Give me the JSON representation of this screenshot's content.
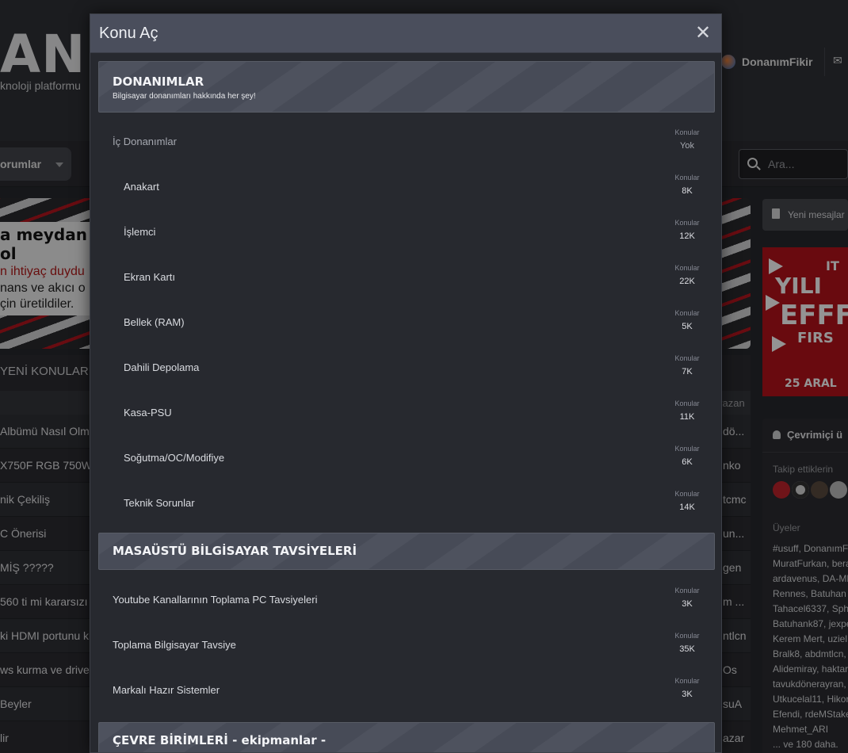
{
  "background": {
    "logo_text": "ANIM",
    "tagline": "knoloji platformu",
    "user_name": "DonanımFikir",
    "nav_forums": "orumlar",
    "search_placeholder": "Ara...",
    "banner": {
      "line1": "a meydan ol",
      "line2": "n ihtiyaç duydu",
      "line3": "nans ve akıcı o",
      "line4": "çin üretildiler."
    },
    "new_topics_title": "YENİ KONULAR",
    "list_author_header": "yazan",
    "rows": [
      {
        "title": "Albümü Nasıl Olm",
        "author": "dö..."
      },
      {
        "title": "X750F RGB 750W",
        "author": "nko"
      },
      {
        "title": "nik Çekiliş",
        "author": "tcmc"
      },
      {
        "title": "C Önerisi",
        "author": "un..."
      },
      {
        "title": "MİŞ ?????",
        "author": "gen"
      },
      {
        "title": "560 ti mi kararsızı",
        "author": "m ..."
      },
      {
        "title": "ki HDMI portunu k",
        "author": "ntlcn"
      },
      {
        "title": "ws kurma ve driver",
        "author": "Os"
      },
      {
        "title": "Beyler",
        "author": "suA"
      },
      {
        "title": "lir",
        "author": "azar"
      }
    ],
    "new_posts_button": "Yeni mesajlar",
    "ad": {
      "it": "IT",
      "line1": "YILI",
      "line2": "EFFF",
      "line3": "FIRS",
      "date": "25 ARAL"
    },
    "online_title": "Çevrimiçi ü",
    "followed_label": "Takip ettiklerin",
    "members_label": "Üyeler",
    "members": [
      "#usuff, DonanımF",
      "MuratFurkan, bera",
      "ardavenus, DA-MD",
      "Rennes, Batuhan A",
      "Tahacel6337, Sphi",
      "Batuhank87, jexpe",
      "Kerem Mert, uziel",
      "Bralk8, abdmtlcn,",
      "Alidemiray, haktar",
      "tavukdönerayran,",
      "Utkucelal11, Hikor",
      "Efendi, rdeMStake",
      "Mehmet_ARI",
      "... ve 180 daha."
    ]
  },
  "modal": {
    "title": "Konu Aç",
    "close_icon": "close-icon",
    "categories": [
      {
        "title": "DONANIMLAR",
        "description": "Bilgisayar donanımları hakkında her şey!",
        "nodes": [
          {
            "name": "İç Donanımlar",
            "stat_label": "Konular",
            "stat_value": "Yok",
            "level": "top",
            "muted": true
          },
          {
            "name": "Anakart",
            "stat_label": "Konular",
            "stat_value": "8K",
            "level": "sub"
          },
          {
            "name": "İşlemci",
            "stat_label": "Konular",
            "stat_value": "12K",
            "level": "sub"
          },
          {
            "name": "Ekran Kartı",
            "stat_label": "Konular",
            "stat_value": "22K",
            "level": "sub"
          },
          {
            "name": "Bellek (RAM)",
            "stat_label": "Konular",
            "stat_value": "5K",
            "level": "sub"
          },
          {
            "name": "Dahili Depolama",
            "stat_label": "Konular",
            "stat_value": "7K",
            "level": "sub"
          },
          {
            "name": "Kasa-PSU",
            "stat_label": "Konular",
            "stat_value": "11K",
            "level": "sub"
          },
          {
            "name": "Soğutma/OC/Modifiye",
            "stat_label": "Konular",
            "stat_value": "6K",
            "level": "sub"
          },
          {
            "name": "Teknik Sorunlar",
            "stat_label": "Konular",
            "stat_value": "14K",
            "level": "sub"
          }
        ]
      },
      {
        "title": "MASAÜSTÜ BİLGİSAYAR TAVSİYELERİ",
        "description": "",
        "nodes": [
          {
            "name": "Youtube Kanallarının Toplama PC Tavsiyeleri",
            "stat_label": "Konular",
            "stat_value": "3K",
            "level": "top"
          },
          {
            "name": "Toplama Bilgisayar Tavsiye",
            "stat_label": "Konular",
            "stat_value": "35K",
            "level": "top"
          },
          {
            "name": "Markalı Hazır Sistemler",
            "stat_label": "Konular",
            "stat_value": "3K",
            "level": "top"
          }
        ]
      },
      {
        "title": "ÇEVRE BİRİMLERİ  - ekipmanlar -",
        "description": "",
        "nodes": []
      }
    ]
  }
}
